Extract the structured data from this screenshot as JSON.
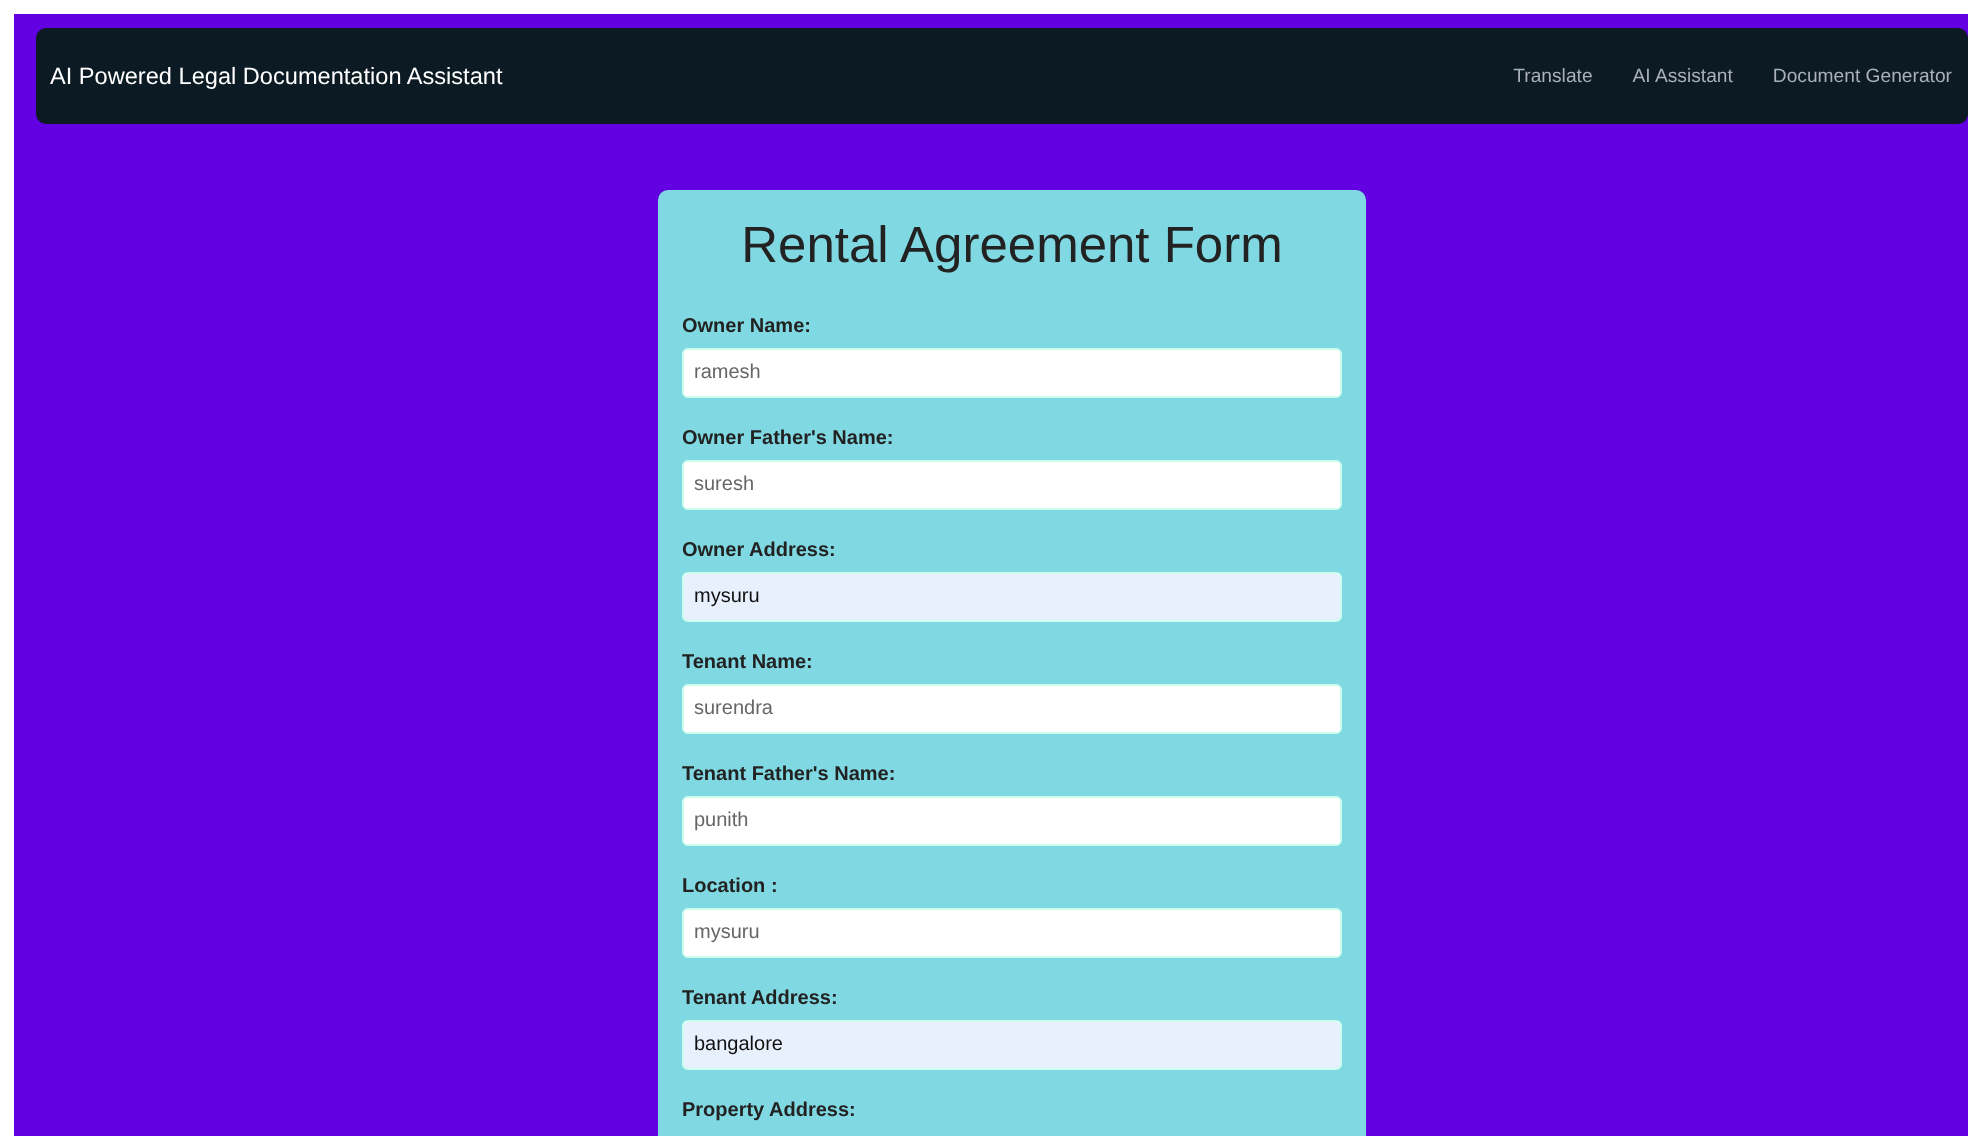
{
  "navbar": {
    "brand": "AI Powered Legal Documentation Assistant",
    "links": [
      {
        "label": "Translate"
      },
      {
        "label": "AI Assistant"
      },
      {
        "label": "Document Generator"
      }
    ]
  },
  "form": {
    "title": "Rental Agreement Form",
    "fields": [
      {
        "label": "Owner Name:",
        "value": "ramesh",
        "autofilled": false
      },
      {
        "label": "Owner Father's Name:",
        "value": "suresh",
        "autofilled": false
      },
      {
        "label": "Owner Address:",
        "value": "mysuru",
        "autofilled": true
      },
      {
        "label": "Tenant Name:",
        "value": "surendra",
        "autofilled": false
      },
      {
        "label": "Tenant Father's Name:",
        "value": "punith",
        "autofilled": false
      },
      {
        "label": "Location :",
        "value": "mysuru",
        "autofilled": false
      },
      {
        "label": "Tenant Address:",
        "value": "bangalore",
        "autofilled": true
      },
      {
        "label": "Property Address:"
      }
    ]
  }
}
